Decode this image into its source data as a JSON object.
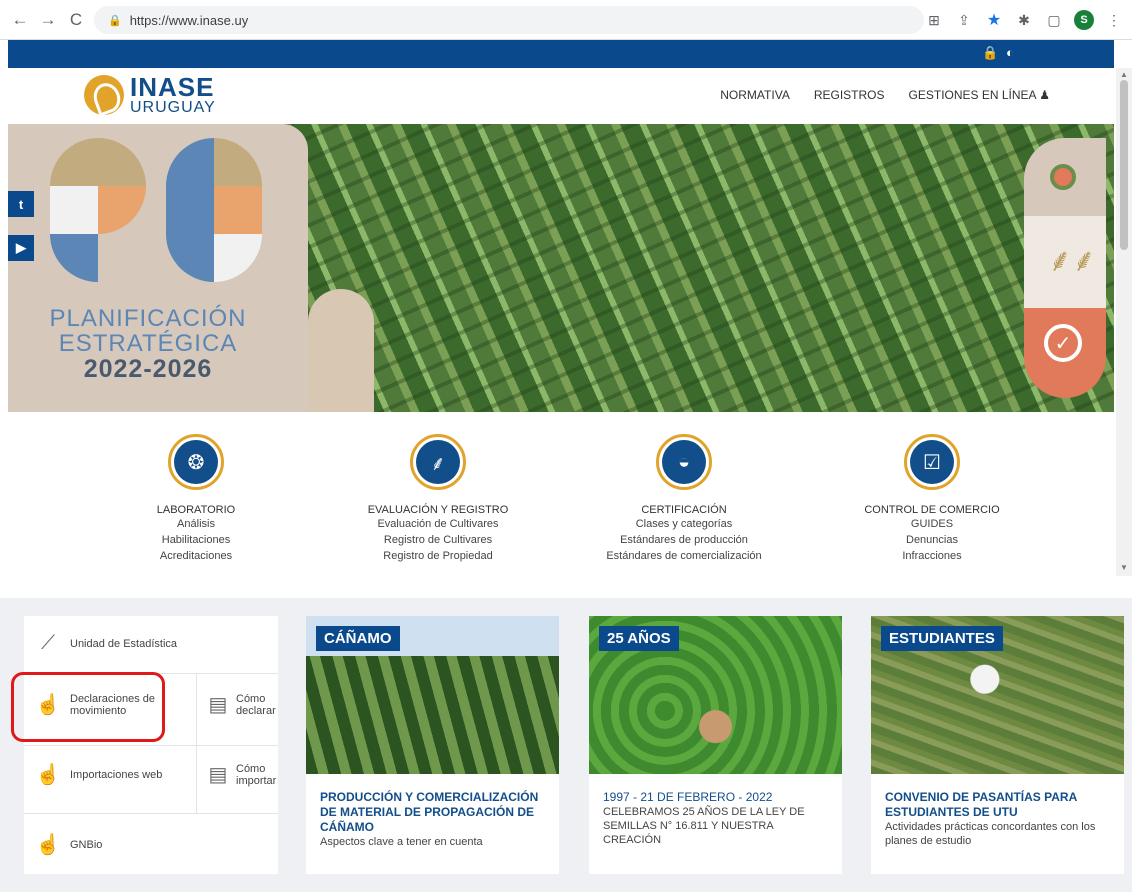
{
  "browser": {
    "url": "https://www.inase.uy",
    "avatar_letter": "S"
  },
  "site": {
    "logo_line1": "INASE",
    "logo_line2": "URUGUAY",
    "nav": [
      "NORMATIVA",
      "REGISTROS",
      "GESTIONES EN LÍNEA"
    ]
  },
  "hero": {
    "title_line1": "PLANIFICACIÓN",
    "title_line2": "ESTRATÉGICA",
    "title_year": "2022-2026"
  },
  "services": [
    {
      "heading": "LABORATORIO",
      "links": [
        "Análisis",
        "Habilitaciones",
        "Acreditaciones"
      ]
    },
    {
      "heading": "EVALUACIÓN Y REGISTRO",
      "links": [
        "Evaluación de Cultivares",
        "Registro de Cultivares",
        "Registro de Propiedad"
      ]
    },
    {
      "heading": "CERTIFICACIÓN",
      "links": [
        "Clases y categorías",
        "Estándares de producción",
        "Estándares de comercialización"
      ]
    },
    {
      "heading": "CONTROL DE COMERCIO",
      "links": [
        "GUIDES",
        "Denuncias",
        "Infracciones"
      ]
    }
  ],
  "panel": {
    "estadistica": "Unidad de Estadística",
    "declaraciones": "Declaraciones de movimiento",
    "como_declarar": "Cómo declarar",
    "importaciones": "Importaciones web",
    "como_importar": "Cómo importar",
    "gnbio": "GNBio"
  },
  "cards": [
    {
      "badge": "CÁÑAMO",
      "title": "PRODUCCIÓN Y COMERCIALIZACIÓN DE MATERIAL DE PROPAGACIÓN DE CÁÑAMO",
      "desc": "Aspectos clave a tener en cuenta"
    },
    {
      "badge": "25 AÑOS",
      "title": "1997 - 21 DE FEBRERO - 2022",
      "desc": "CELEBRAMOS 25 AÑOS DE LA LEY DE SEMILLAS N° 16.811 Y NUESTRA CREACIÓN"
    },
    {
      "badge": "ESTUDIANTES",
      "title": "CONVENIO DE PASANTÍAS PARA ESTUDIANTES DE UTU",
      "desc": "Actividades prácticas concordantes con los planes de estudio"
    }
  ],
  "colors": {
    "brand_blue": "#0a4a8c",
    "brand_gold": "#e2a32b",
    "annotation_red": "#e01818"
  }
}
